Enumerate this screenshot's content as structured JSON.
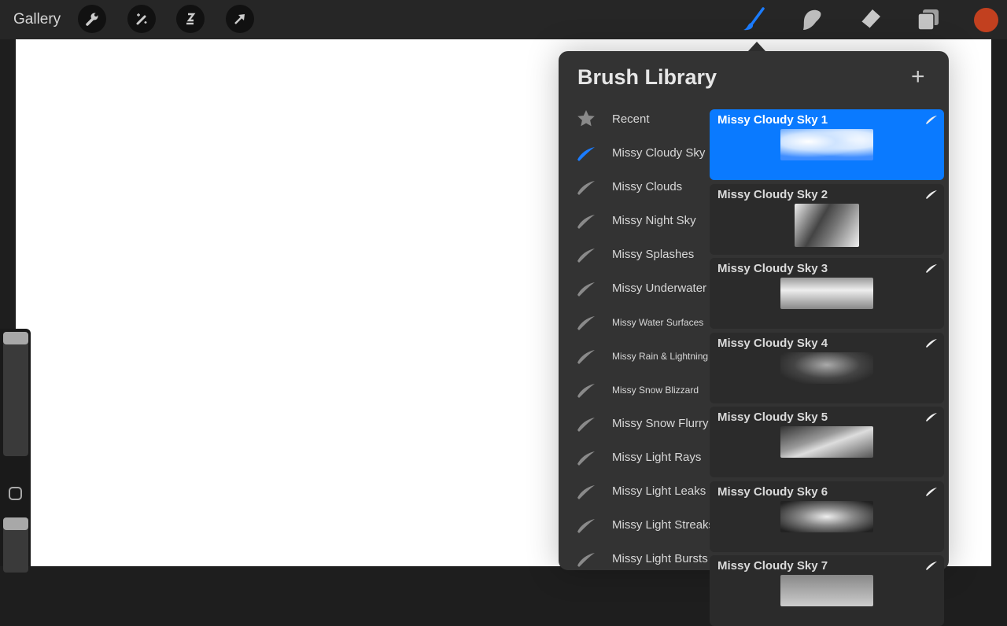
{
  "topbar": {
    "gallery_label": "Gallery",
    "left_tools": [
      "wrench-icon",
      "magic-wand-icon",
      "selection-icon",
      "transform-arrow-icon"
    ],
    "right_tools": [
      "brush-icon",
      "smudge-icon",
      "eraser-icon",
      "layers-icon"
    ],
    "color": "#c2401f",
    "accent": "#0a7aff"
  },
  "library": {
    "title": "Brush Library",
    "add_label": "+",
    "sets": [
      {
        "label": "Recent",
        "icon": "star-icon"
      },
      {
        "label": "Missy Cloudy Sky",
        "active": true
      },
      {
        "label": "Missy Clouds"
      },
      {
        "label": "Missy Night Sky"
      },
      {
        "label": "Missy Splashes"
      },
      {
        "label": "Missy Underwater"
      },
      {
        "label": "Missy Water Surfaces",
        "small": true
      },
      {
        "label": "Missy Rain & Lightning",
        "small": true
      },
      {
        "label": "Missy Snow Blizzard",
        "small": true
      },
      {
        "label": "Missy Snow Flurry"
      },
      {
        "label": "Missy Light Rays"
      },
      {
        "label": "Missy Light Leaks"
      },
      {
        "label": "Missy Light Streaks"
      },
      {
        "label": "Missy Light Bursts"
      }
    ],
    "brushes": [
      {
        "name": "Missy Cloudy Sky 1",
        "selected": true
      },
      {
        "name": "Missy Cloudy Sky 2"
      },
      {
        "name": "Missy Cloudy Sky 3"
      },
      {
        "name": "Missy Cloudy Sky 4"
      },
      {
        "name": "Missy Cloudy Sky 5"
      },
      {
        "name": "Missy Cloudy Sky 6"
      },
      {
        "name": "Missy Cloudy Sky 7"
      }
    ]
  }
}
